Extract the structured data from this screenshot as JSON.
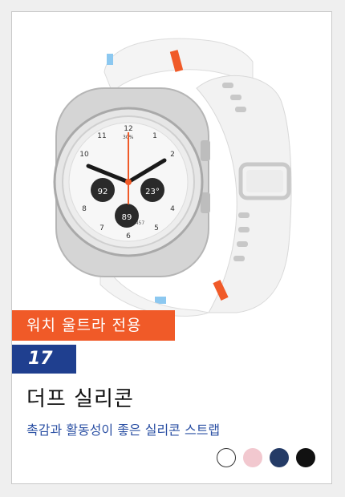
{
  "tag": {
    "label": "워치 울트라 전용"
  },
  "rank": {
    "number": "17"
  },
  "product": {
    "title": "더프 실리콘",
    "subtitle": "촉감과 활동성이 좋은 실리콘 스트랩"
  },
  "watch_face": {
    "battery": "30%",
    "left_dial": "92",
    "right_dial": "23°",
    "bottom_dial": "89",
    "steps": "3,457",
    "hour_numbers": [
      "12",
      "1",
      "2",
      "4",
      "5",
      "6",
      "7",
      "8",
      "10",
      "11"
    ]
  },
  "colors": {
    "tag_bg": "#f05a28",
    "rank_bg": "#1f3f8f",
    "subtitle": "#2a4fa3"
  },
  "swatches": [
    {
      "name": "white",
      "color": "#ffffff",
      "border": "#333333"
    },
    {
      "name": "pink",
      "color": "#f2c8cf",
      "border": "#f2c8cf"
    },
    {
      "name": "navy",
      "color": "#243b66",
      "border": "#243b66"
    },
    {
      "name": "black",
      "color": "#111111",
      "border": "#111111"
    }
  ]
}
